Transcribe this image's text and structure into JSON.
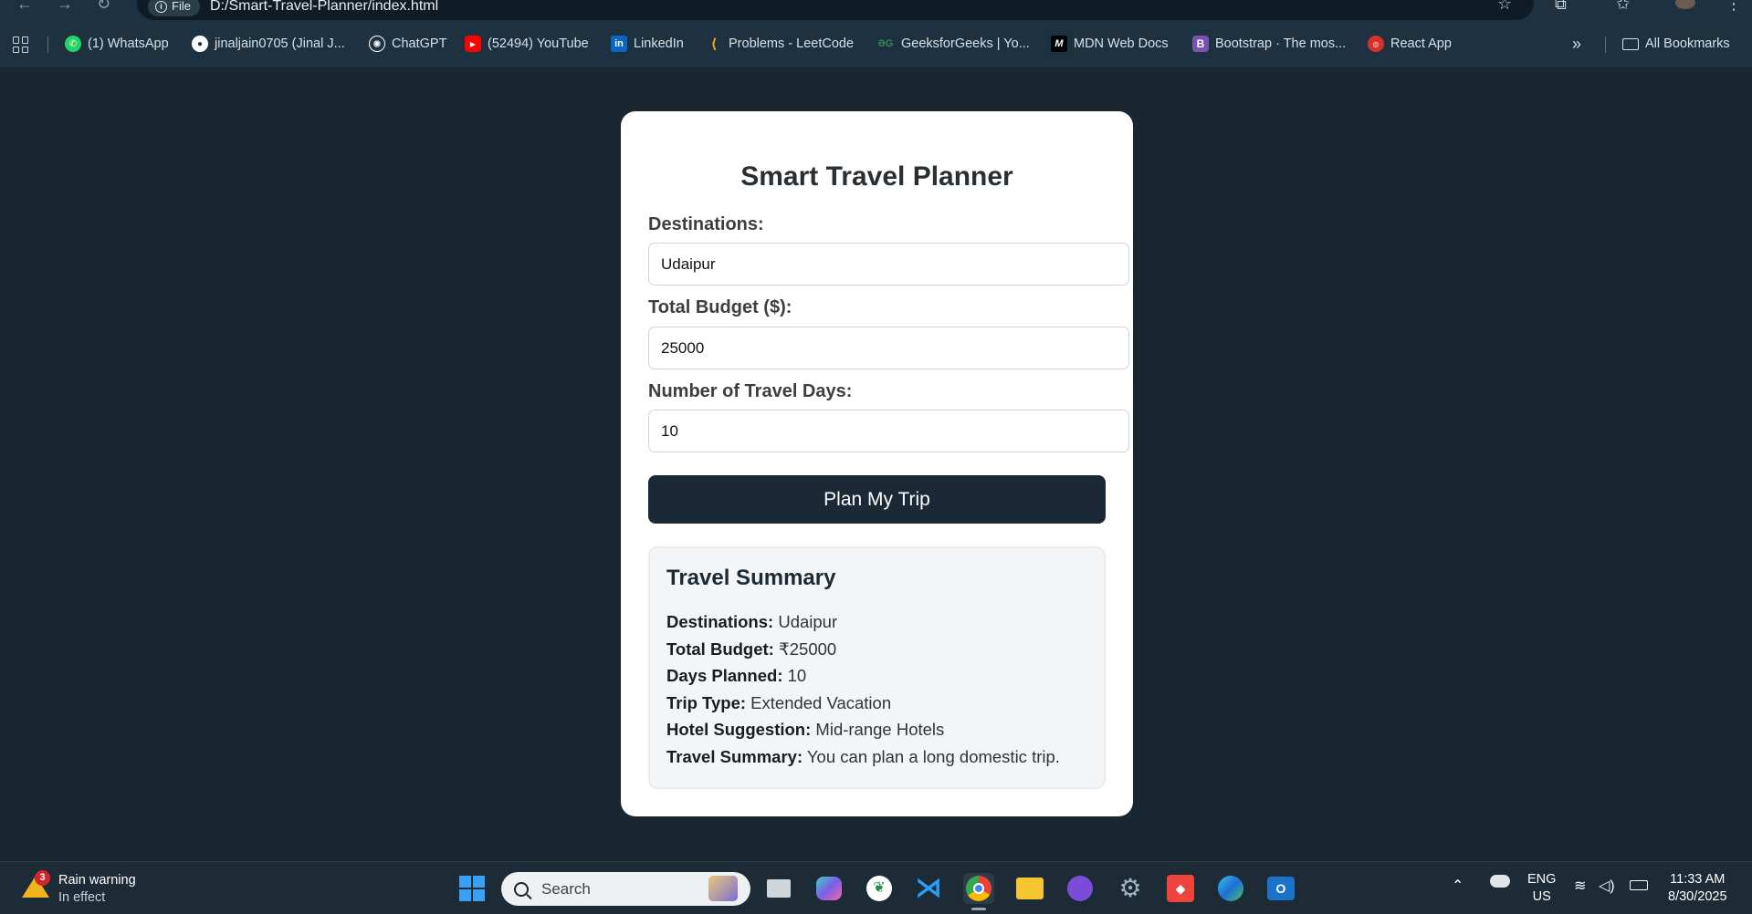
{
  "browser": {
    "file_chip": "File",
    "url": "D:/Smart-Travel-Planner/index.html",
    "bookmarks": [
      {
        "label": "(1) WhatsApp",
        "icon": "whatsapp-icon",
        "color": "#25d366"
      },
      {
        "label": "jinaljain0705 (Jinal J...",
        "icon": "github-icon",
        "color": "#ffffff"
      },
      {
        "label": "ChatGPT",
        "icon": "chatgpt-icon",
        "color": "#ffffff"
      },
      {
        "label": "(52494) YouTube",
        "icon": "youtube-icon",
        "color": "#ff0000"
      },
      {
        "label": "LinkedIn",
        "icon": "linkedin-icon",
        "color": "#0a66c2"
      },
      {
        "label": "Problems - LeetCode",
        "icon": "leetcode-icon",
        "color": "#ffa116"
      },
      {
        "label": "GeeksforGeeks | Yo...",
        "icon": "geeksforgeeks-icon",
        "color": "#2f8d46"
      },
      {
        "label": "MDN Web Docs",
        "icon": "mdn-icon",
        "color": "#000000"
      },
      {
        "label": "Bootstrap · The mos...",
        "icon": "bootstrap-icon",
        "color": "#7952b3"
      },
      {
        "label": "React App",
        "icon": "react-icon",
        "color": "#d9302a"
      }
    ],
    "all_bookmarks": "All Bookmarks"
  },
  "form": {
    "title": "Smart Travel Planner",
    "destinations_label": "Destinations:",
    "destinations_value": "Udaipur",
    "budget_label": "Total Budget ($):",
    "budget_value": "25000",
    "days_label": "Number of Travel Days:",
    "days_value": "10",
    "submit_label": "Plan My Trip"
  },
  "summary": {
    "title": "Travel Summary",
    "rows": [
      {
        "key": "Destinations:",
        "value": " Udaipur"
      },
      {
        "key": "Total Budget:",
        "value": " ₹25000"
      },
      {
        "key": "Days Planned:",
        "value": " 10"
      },
      {
        "key": "Trip Type:",
        "value": " Extended Vacation"
      },
      {
        "key": "Hotel Suggestion:",
        "value": " Mid-range Hotels"
      },
      {
        "key": "Travel Summary:",
        "value": " You can plan a long domestic trip."
      }
    ]
  },
  "taskbar": {
    "weather_badge": "3",
    "weather_title": "Rain warning",
    "weather_sub": "In effect",
    "search_placeholder": "Search",
    "lang_line1": "ENG",
    "lang_line2": "US",
    "time": "11:33 AM",
    "date": "8/30/2025"
  }
}
